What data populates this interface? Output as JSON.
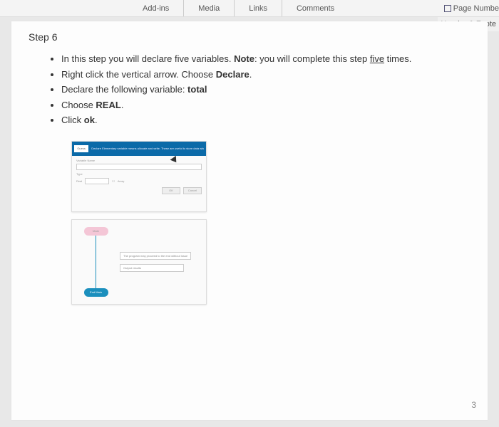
{
  "ribbon": {
    "addins": "Add-ins",
    "media": "Media",
    "links": "Links",
    "comments": "Comments",
    "pageNumb": "Page Numbe",
    "headerFooter": "Header & Foote"
  },
  "doc": {
    "step": "Step 6",
    "b1_a": "In this step you will declare five variables. ",
    "b1_note": "Note",
    "b1_b": ": you will complete this step ",
    "b1_u": "five",
    "b1_c": " times.",
    "b2_a": "Right click the vertical arrow. Choose ",
    "b2_b": "Declare",
    "b2_c": ".",
    "b3_a": "Declare the following variable:  ",
    "b3_b": "total",
    "b4_a": "Choose ",
    "b4_b": "REAL",
    "b4_c": ".",
    "b5_a": "Click ",
    "b5_b": "ok",
    "b5_c": "."
  },
  "thumb1": {
    "btn": "Guess",
    "barText": "Declare Elementary variable means allocate and write. These are useful to store data when the program...",
    "lbl1": "Variable Name",
    "lbl2": "Type",
    "lbl3": "Real",
    "chk": "Array",
    "ok": "OK",
    "cancel": "Cancel"
  },
  "thumb2": {
    "start": "Main",
    "box1": "The program may proceed to the end without issue",
    "box2": "Output results",
    "end": "End Main"
  },
  "pageCorner": "3"
}
